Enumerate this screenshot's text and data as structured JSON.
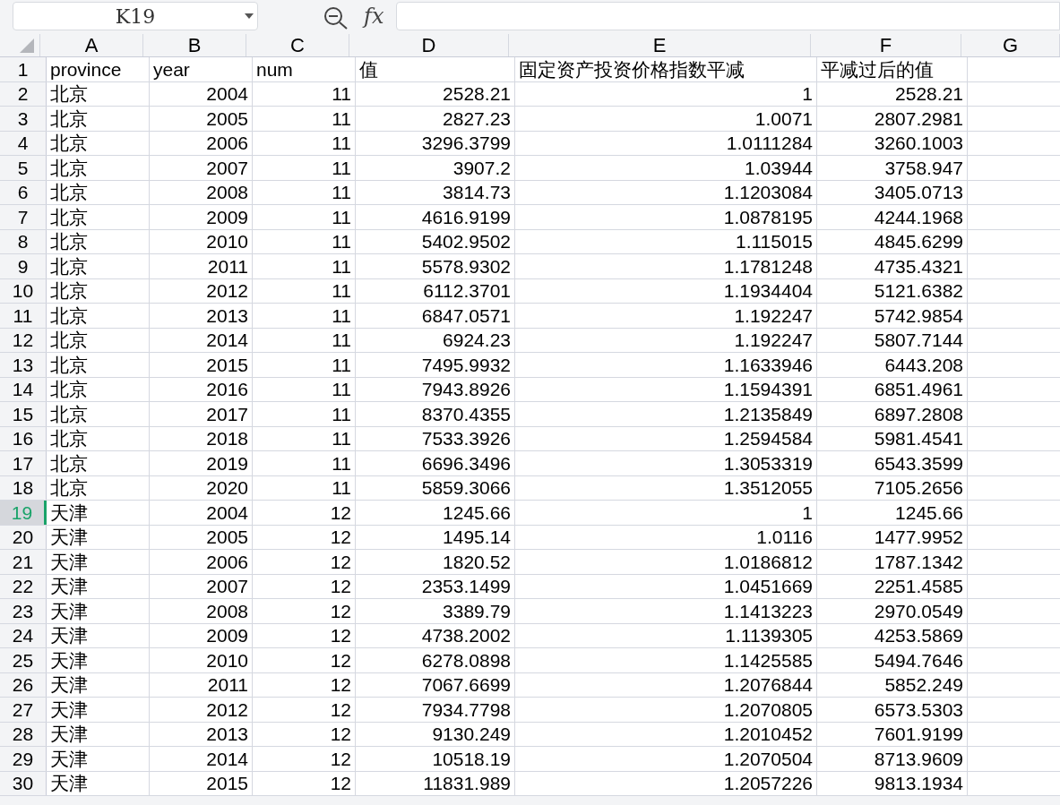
{
  "name_box": "K19",
  "formula_bar": {
    "value_icon": "fx"
  },
  "columns": [
    {
      "label": "A",
      "selected": false
    },
    {
      "label": "B",
      "selected": false
    },
    {
      "label": "C",
      "selected": false
    },
    {
      "label": "D",
      "selected": false
    },
    {
      "label": "E",
      "selected": false
    },
    {
      "label": "F",
      "selected": false
    },
    {
      "label": "G",
      "selected": false
    }
  ],
  "rows": [
    {
      "number": "1",
      "selected": false,
      "cells": [
        "province",
        "year",
        "num",
        "值",
        "固定资产投资价格指数平减",
        "平减过后的值"
      ]
    },
    {
      "number": "2",
      "selected": false,
      "cells": [
        "北京",
        "2004",
        "11",
        "2528.21",
        "1",
        "2528.21"
      ]
    },
    {
      "number": "3",
      "selected": false,
      "cells": [
        "北京",
        "2005",
        "11",
        "2827.23",
        "1.0071",
        "2807.2981"
      ]
    },
    {
      "number": "4",
      "selected": false,
      "cells": [
        "北京",
        "2006",
        "11",
        "3296.3799",
        "1.0111284",
        "3260.1003"
      ]
    },
    {
      "number": "5",
      "selected": false,
      "cells": [
        "北京",
        "2007",
        "11",
        "3907.2",
        "1.03944",
        "3758.947"
      ]
    },
    {
      "number": "6",
      "selected": false,
      "cells": [
        "北京",
        "2008",
        "11",
        "3814.73",
        "1.1203084",
        "3405.0713"
      ]
    },
    {
      "number": "7",
      "selected": false,
      "cells": [
        "北京",
        "2009",
        "11",
        "4616.9199",
        "1.0878195",
        "4244.1968"
      ]
    },
    {
      "number": "8",
      "selected": false,
      "cells": [
        "北京",
        "2010",
        "11",
        "5402.9502",
        "1.115015",
        "4845.6299"
      ]
    },
    {
      "number": "9",
      "selected": false,
      "cells": [
        "北京",
        "2011",
        "11",
        "5578.9302",
        "1.1781248",
        "4735.4321"
      ]
    },
    {
      "number": "10",
      "selected": false,
      "cells": [
        "北京",
        "2012",
        "11",
        "6112.3701",
        "1.1934404",
        "5121.6382"
      ]
    },
    {
      "number": "11",
      "selected": false,
      "cells": [
        "北京",
        "2013",
        "11",
        "6847.0571",
        "1.192247",
        "5742.9854"
      ]
    },
    {
      "number": "12",
      "selected": false,
      "cells": [
        "北京",
        "2014",
        "11",
        "6924.23",
        "1.192247",
        "5807.7144"
      ]
    },
    {
      "number": "13",
      "selected": false,
      "cells": [
        "北京",
        "2015",
        "11",
        "7495.9932",
        "1.1633946",
        "6443.208"
      ]
    },
    {
      "number": "14",
      "selected": false,
      "cells": [
        "北京",
        "2016",
        "11",
        "7943.8926",
        "1.1594391",
        "6851.4961"
      ]
    },
    {
      "number": "15",
      "selected": false,
      "cells": [
        "北京",
        "2017",
        "11",
        "8370.4355",
        "1.2135849",
        "6897.2808"
      ]
    },
    {
      "number": "16",
      "selected": false,
      "cells": [
        "北京",
        "2018",
        "11",
        "7533.3926",
        "1.2594584",
        "5981.4541"
      ]
    },
    {
      "number": "17",
      "selected": false,
      "cells": [
        "北京",
        "2019",
        "11",
        "6696.3496",
        "1.3053319",
        "6543.3599"
      ]
    },
    {
      "number": "18",
      "selected": false,
      "cells": [
        "北京",
        "2020",
        "11",
        "5859.3066",
        "1.3512055",
        "7105.2656"
      ]
    },
    {
      "number": "19",
      "selected": true,
      "cells": [
        "天津",
        "2004",
        "12",
        "1245.66",
        "1",
        "1245.66"
      ]
    },
    {
      "number": "20",
      "selected": false,
      "cells": [
        "天津",
        "2005",
        "12",
        "1495.14",
        "1.0116",
        "1477.9952"
      ]
    },
    {
      "number": "21",
      "selected": false,
      "cells": [
        "天津",
        "2006",
        "12",
        "1820.52",
        "1.0186812",
        "1787.1342"
      ]
    },
    {
      "number": "22",
      "selected": false,
      "cells": [
        "天津",
        "2007",
        "12",
        "2353.1499",
        "1.0451669",
        "2251.4585"
      ]
    },
    {
      "number": "23",
      "selected": false,
      "cells": [
        "天津",
        "2008",
        "12",
        "3389.79",
        "1.1413223",
        "2970.0549"
      ]
    },
    {
      "number": "24",
      "selected": false,
      "cells": [
        "天津",
        "2009",
        "12",
        "4738.2002",
        "1.1139305",
        "4253.5869"
      ]
    },
    {
      "number": "25",
      "selected": false,
      "cells": [
        "天津",
        "2010",
        "12",
        "6278.0898",
        "1.1425585",
        "5494.7646"
      ]
    },
    {
      "number": "26",
      "selected": false,
      "cells": [
        "天津",
        "2011",
        "12",
        "7067.6699",
        "1.2076844",
        "5852.249"
      ]
    },
    {
      "number": "27",
      "selected": false,
      "cells": [
        "天津",
        "2012",
        "12",
        "7934.7798",
        "1.2070805",
        "6573.5303"
      ]
    },
    {
      "number": "28",
      "selected": false,
      "cells": [
        "天津",
        "2013",
        "12",
        "9130.249",
        "1.2010452",
        "7601.9199"
      ]
    },
    {
      "number": "29",
      "selected": false,
      "cells": [
        "天津",
        "2014",
        "12",
        "10518.19",
        "1.2070504",
        "8713.9609"
      ]
    },
    {
      "number": "30",
      "selected": false,
      "cells": [
        "天津",
        "2015",
        "12",
        "11831.989",
        "1.2057226",
        "9813.1934"
      ]
    }
  ]
}
